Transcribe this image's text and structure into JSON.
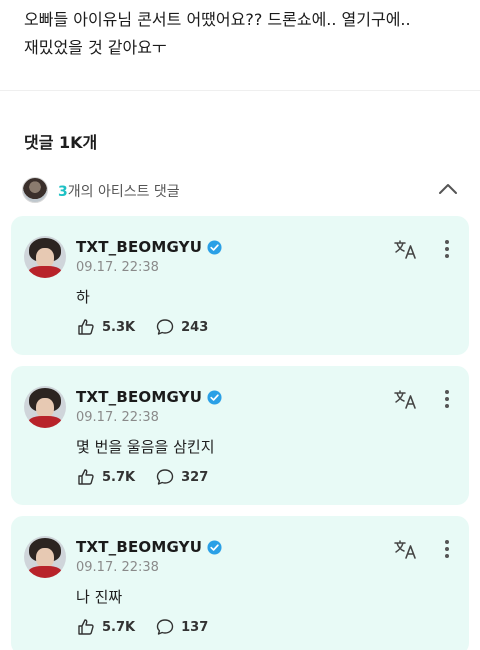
{
  "post": {
    "text": "오빠들 아이유님 콘서트 어땠어요?? 드론쇼에.. 열기구에..\n재밌었을 것 같아요ㅜ"
  },
  "comments_header": {
    "label": "댓글 1K개"
  },
  "artist_section": {
    "count": "3",
    "label_suffix": "개의 아티스트 댓글"
  },
  "comments": [
    {
      "author": "TXT_BEOMGYU",
      "time": "09.17. 22:38",
      "text": "하",
      "likes": "5.3K",
      "replies": "243"
    },
    {
      "author": "TXT_BEOMGYU",
      "time": "09.17. 22:38",
      "text": "몇 번을 울음을 삼킨지",
      "likes": "5.7K",
      "replies": "327"
    },
    {
      "author": "TXT_BEOMGYU",
      "time": "09.17. 22:38",
      "text": "나 진짜",
      "likes": "5.7K",
      "replies": "137"
    }
  ],
  "icons": {
    "verified": "verified-badge-icon",
    "translate": "translate-icon",
    "more": "more-vertical-icon",
    "like": "like-hand-icon",
    "reply": "reply-bubble-icon",
    "collapse": "chevron-up-icon"
  },
  "colors": {
    "accent": "#1ec1c5",
    "card_bg": "#e8faf6",
    "verified": "#2aa0e6"
  }
}
